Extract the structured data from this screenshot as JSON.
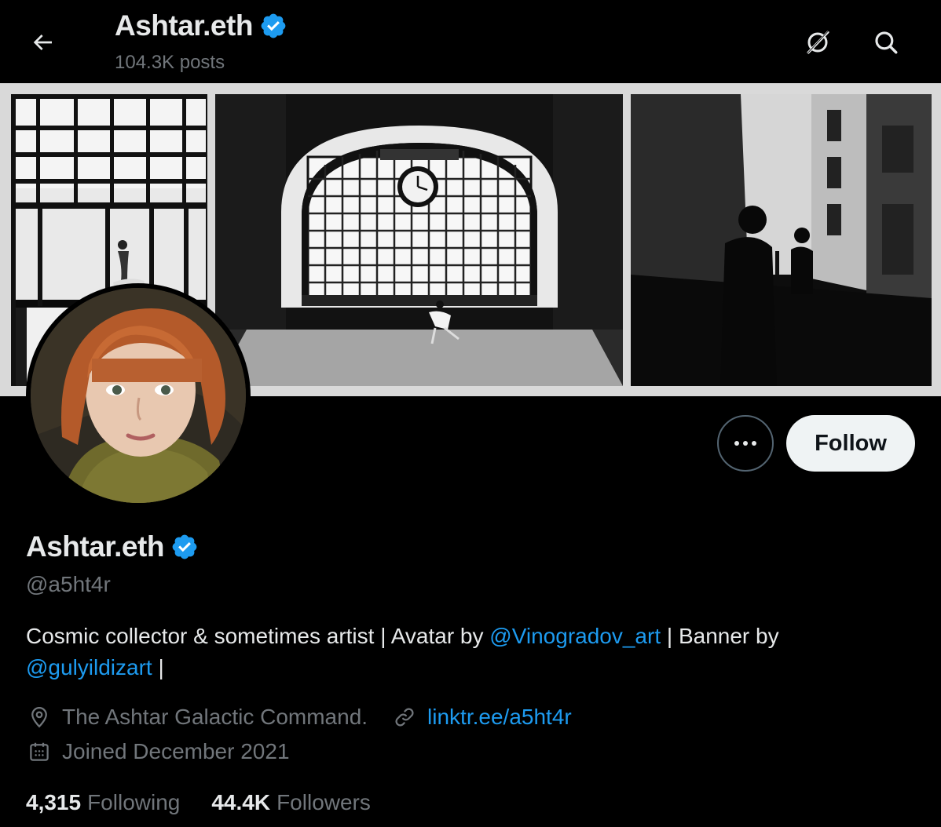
{
  "header": {
    "display_name": "Ashtar.eth",
    "posts_count": "104.3K posts",
    "back_icon": "arrow-left-icon",
    "grok_icon": "grok-icon",
    "search_icon": "search-icon"
  },
  "profile": {
    "display_name": "Ashtar.eth",
    "verified": true,
    "handle": "@a5ht4r",
    "bio": {
      "text_1": "Cosmic collector & sometimes artist | Avatar by ",
      "mention_1": "@Vinogradov_art",
      "text_2": " | Banner by ",
      "mention_2": "@gulyildizart",
      "text_3": " |"
    },
    "location": "The Ashtar Galactic Command.",
    "website": "linktr.ee/a5ht4r",
    "joined": "Joined December 2021",
    "following_count": "4,315",
    "following_label": "Following",
    "followers_count": "44.4K",
    "followers_label": "Followers"
  },
  "actions": {
    "follow_label": "Follow",
    "more_icon": "more-horizontal-icon"
  },
  "colors": {
    "background": "#000000",
    "text_primary": "#e7e9ea",
    "text_secondary": "#71767b",
    "link": "#1d9bf0",
    "verified_badge": "#1d9bf0",
    "follow_button_bg": "#eff3f4",
    "follow_button_text": "#0f1419"
  }
}
